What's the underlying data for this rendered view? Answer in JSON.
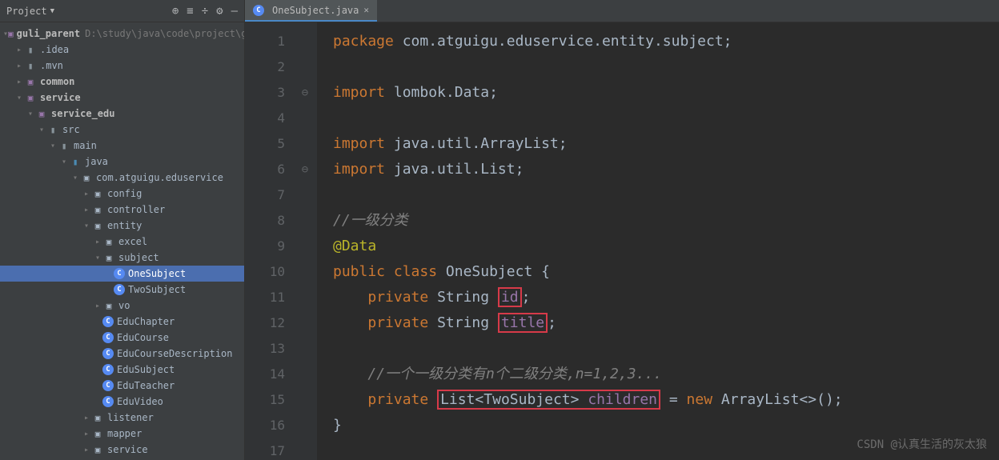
{
  "sidebar": {
    "title": "Project",
    "root": {
      "name": "guli_parent",
      "path": "D:\\study\\java\\code\\project\\guli_paren"
    },
    "items": [
      {
        "level": 1,
        "arrow": "collapsed",
        "icon": "folder",
        "label": ".idea"
      },
      {
        "level": 1,
        "arrow": "collapsed",
        "icon": "folder",
        "label": ".mvn"
      },
      {
        "level": 1,
        "arrow": "collapsed",
        "icon": "module",
        "label": "common",
        "bold": true
      },
      {
        "level": 1,
        "arrow": "expanded",
        "icon": "module",
        "label": "service",
        "bold": true
      },
      {
        "level": 2,
        "arrow": "expanded",
        "icon": "module",
        "label": "service_edu",
        "bold": true
      },
      {
        "level": 3,
        "arrow": "expanded",
        "icon": "folder",
        "label": "src"
      },
      {
        "level": 4,
        "arrow": "expanded",
        "icon": "folder",
        "label": "main"
      },
      {
        "level": 5,
        "arrow": "expanded",
        "icon": "folder-blue",
        "label": "java"
      },
      {
        "level": 6,
        "arrow": "expanded",
        "icon": "package",
        "label": "com.atguigu.eduservice"
      },
      {
        "level": 7,
        "arrow": "collapsed",
        "icon": "package",
        "label": "config"
      },
      {
        "level": 7,
        "arrow": "collapsed",
        "icon": "package",
        "label": "controller"
      },
      {
        "level": 7,
        "arrow": "expanded",
        "icon": "package",
        "label": "entity"
      },
      {
        "level": 8,
        "arrow": "collapsed",
        "icon": "package",
        "label": "excel"
      },
      {
        "level": 8,
        "arrow": "expanded",
        "icon": "package",
        "label": "subject"
      },
      {
        "level": 9,
        "arrow": "",
        "icon": "class",
        "label": "OneSubject",
        "selected": true
      },
      {
        "level": 9,
        "arrow": "",
        "icon": "class",
        "label": "TwoSubject"
      },
      {
        "level": 8,
        "arrow": "collapsed",
        "icon": "package",
        "label": "vo"
      },
      {
        "level": 8,
        "arrow": "",
        "icon": "class",
        "label": "EduChapter"
      },
      {
        "level": 8,
        "arrow": "",
        "icon": "class",
        "label": "EduCourse"
      },
      {
        "level": 8,
        "arrow": "",
        "icon": "class",
        "label": "EduCourseDescription"
      },
      {
        "level": 8,
        "arrow": "",
        "icon": "class",
        "label": "EduSubject"
      },
      {
        "level": 8,
        "arrow": "",
        "icon": "class",
        "label": "EduTeacher"
      },
      {
        "level": 8,
        "arrow": "",
        "icon": "class",
        "label": "EduVideo"
      },
      {
        "level": 7,
        "arrow": "collapsed",
        "icon": "package",
        "label": "listener"
      },
      {
        "level": 7,
        "arrow": "collapsed",
        "icon": "package",
        "label": "mapper"
      },
      {
        "level": 7,
        "arrow": "collapsed",
        "icon": "package",
        "label": "service"
      }
    ]
  },
  "tab": {
    "filename": "OneSubject.java"
  },
  "code": {
    "package_kw": "package",
    "package_name": "com.atguigu.eduservice.entity.subject",
    "import_kw": "import",
    "import1": "lombok.Data",
    "import2": "java.util.ArrayList",
    "import3": "java.util.List",
    "comment1": "//一级分类",
    "annotation": "@Data",
    "public_kw": "public",
    "class_kw": "class",
    "class_name": "OneSubject",
    "private_kw": "private",
    "string_type": "String",
    "field_id": "id",
    "field_title": "title",
    "comment2": "//一个一级分类有n个二级分类,n=1,2,3...",
    "list_type": "List",
    "two_subject": "TwoSubject",
    "field_children": "children",
    "new_kw": "new",
    "arraylist": "ArrayList",
    "line_numbers": [
      "1",
      "2",
      "3",
      "4",
      "5",
      "6",
      "7",
      "8",
      "9",
      "10",
      "11",
      "12",
      "13",
      "14",
      "15",
      "16",
      "17"
    ]
  },
  "watermark": "CSDN @认真生活的灰太狼"
}
